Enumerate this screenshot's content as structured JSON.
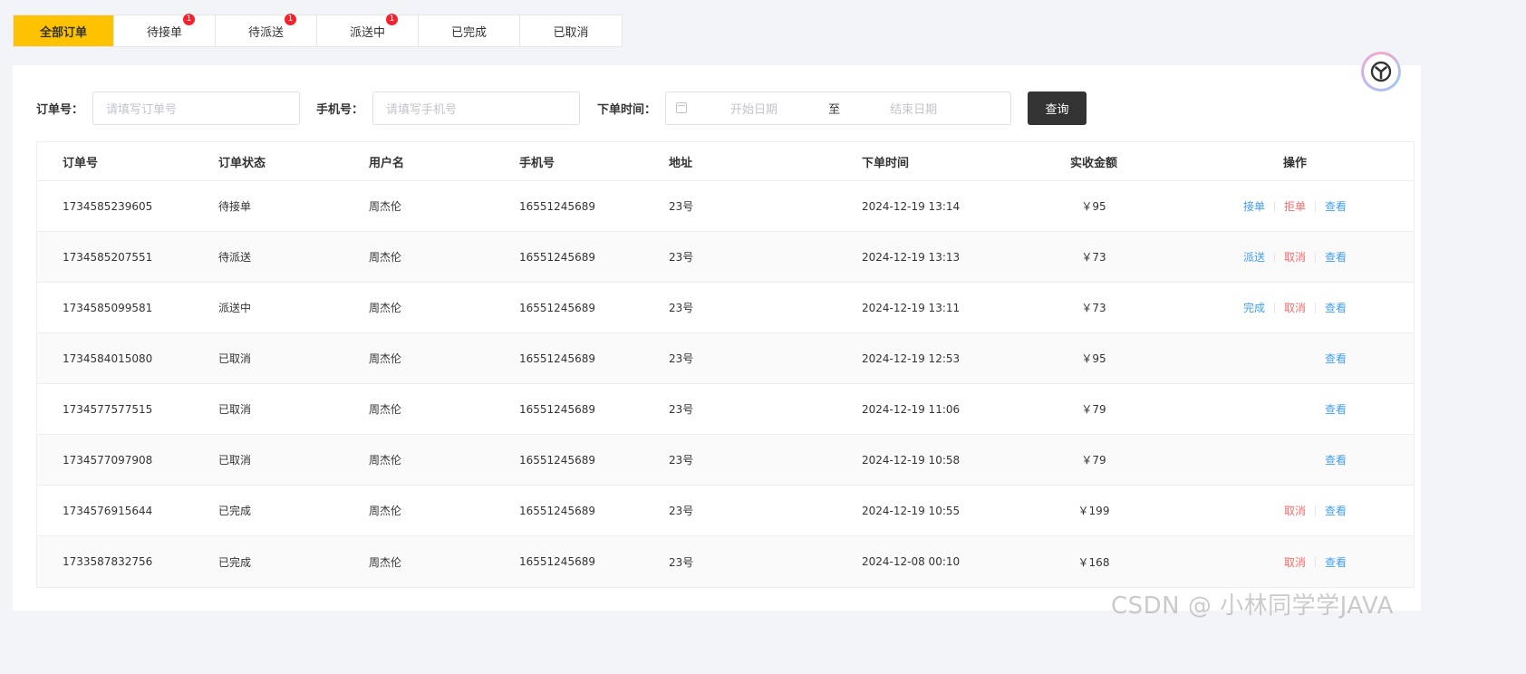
{
  "tabs": [
    {
      "label": "全部订单",
      "badge": ""
    },
    {
      "label": "待接单",
      "badge": "1"
    },
    {
      "label": "待派送",
      "badge": "1"
    },
    {
      "label": "派送中",
      "badge": "1"
    },
    {
      "label": "已完成",
      "badge": ""
    },
    {
      "label": "已取消",
      "badge": ""
    }
  ],
  "filter": {
    "order_label": "订单号：",
    "order_placeholder": "请填写订单号",
    "phone_label": "手机号：",
    "phone_placeholder": "请填写手机号",
    "time_label": "下单时间：",
    "start_placeholder": "开始日期",
    "range_sep": "至",
    "end_placeholder": "结束日期",
    "query_label": "查询"
  },
  "table": {
    "headers": [
      "订单号",
      "订单状态",
      "用户名",
      "手机号",
      "地址",
      "下单时间",
      "实收金额",
      "操作"
    ],
    "rows": [
      {
        "order": "1734585239605",
        "status": "待接单",
        "user": "周杰伦",
        "phone": "16551245689",
        "addr": "23号",
        "time": "2024-12-19 13:14",
        "amount": "￥95",
        "op1": "接单",
        "op2": "拒单",
        "op3": "查看"
      },
      {
        "order": "1734585207551",
        "status": "待派送",
        "user": "周杰伦",
        "phone": "16551245689",
        "addr": "23号",
        "time": "2024-12-19 13:13",
        "amount": "￥73",
        "op1": "派送",
        "op2": "取消",
        "op3": "查看"
      },
      {
        "order": "1734585099581",
        "status": "派送中",
        "user": "周杰伦",
        "phone": "16551245689",
        "addr": "23号",
        "time": "2024-12-19 13:11",
        "amount": "￥73",
        "op1": "完成",
        "op2": "取消",
        "op3": "查看"
      },
      {
        "order": "1734584015080",
        "status": "已取消",
        "user": "周杰伦",
        "phone": "16551245689",
        "addr": "23号",
        "time": "2024-12-19 12:53",
        "amount": "￥95",
        "op1": "",
        "op2": "",
        "op3": "查看"
      },
      {
        "order": "1734577577515",
        "status": "已取消",
        "user": "周杰伦",
        "phone": "16551245689",
        "addr": "23号",
        "time": "2024-12-19 11:06",
        "amount": "￥79",
        "op1": "",
        "op2": "",
        "op3": "查看"
      },
      {
        "order": "1734577097908",
        "status": "已取消",
        "user": "周杰伦",
        "phone": "16551245689",
        "addr": "23号",
        "time": "2024-12-19 10:58",
        "amount": "￥79",
        "op1": "",
        "op2": "",
        "op3": "查看"
      },
      {
        "order": "1734576915644",
        "status": "已完成",
        "user": "周杰伦",
        "phone": "16551245689",
        "addr": "23号",
        "time": "2024-12-19 10:55",
        "amount": "￥199",
        "op1": "",
        "op2": "取消",
        "op3": "查看"
      },
      {
        "order": "1733587832756",
        "status": "已完成",
        "user": "周杰伦",
        "phone": "16551245689",
        "addr": "23号",
        "time": "2024-12-08 00:10",
        "amount": "￥168",
        "op1": "",
        "op2": "取消",
        "op3": "查看"
      }
    ]
  },
  "watermark": "CSDN @ 小林同学学JAVA",
  "colors": {
    "accent": "#ffc200",
    "link_blue": "#419efa",
    "link_red": "#f56c6c",
    "badge_red": "#f5222d",
    "button_dark": "#333333"
  }
}
